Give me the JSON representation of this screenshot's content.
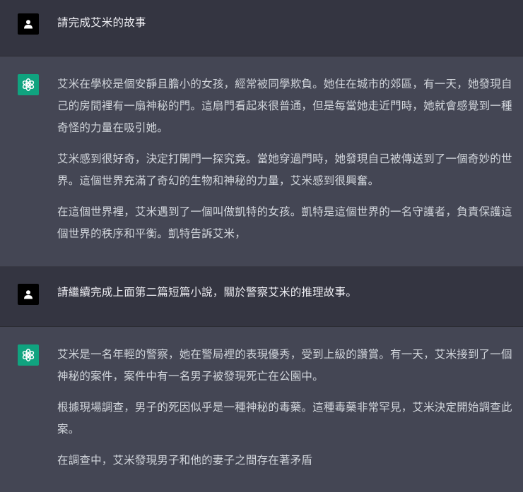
{
  "conversation": {
    "turns": [
      {
        "role": "user",
        "text": "請完成艾米的故事"
      },
      {
        "role": "assistant",
        "paragraphs": [
          "艾米在學校是個安靜且膽小的女孩，經常被同學欺負。她住在城市的郊區，有一天，她發現自己的房間裡有一扇神秘的門。這扇門看起來很普通，但是每當她走近門時，她就會感覺到一種奇怪的力量在吸引她。",
          "艾米感到很好奇，決定打開門一探究竟。當她穿過門時，她發現自己被傳送到了一個奇妙的世界。這個世界充滿了奇幻的生物和神秘的力量，艾米感到很興奮。",
          "在這個世界裡，艾米遇到了一個叫做凱特的女孩。凱特是這個世界的一名守護者，負責保護這個世界的秩序和平衡。凱特告訴艾米，"
        ]
      },
      {
        "role": "user",
        "text": "請繼續完成上面第二篇短篇小說，關於警察艾米的推理故事。"
      },
      {
        "role": "assistant",
        "paragraphs": [
          "艾米是一名年輕的警察，她在警局裡的表現優秀，受到上級的讚賞。有一天，艾米接到了一個神秘的案件，案件中有一名男子被發現死亡在公園中。",
          "根據現場調查，男子的死因似乎是一種神秘的毒藥。這種毒藥非常罕見，艾米決定開始調查此案。",
          "在調查中，艾米發現男子和他的妻子之間存在著矛盾"
        ]
      }
    ]
  },
  "icons": {
    "user_avatar": "user-silhouette-icon",
    "assistant_avatar": "openai-logo-icon"
  },
  "colors": {
    "user_bg": "#343541",
    "assistant_bg": "#444654",
    "assistant_avatar_bg": "#10a37f",
    "user_avatar_bg": "#000000",
    "text": "#d1d5db"
  }
}
